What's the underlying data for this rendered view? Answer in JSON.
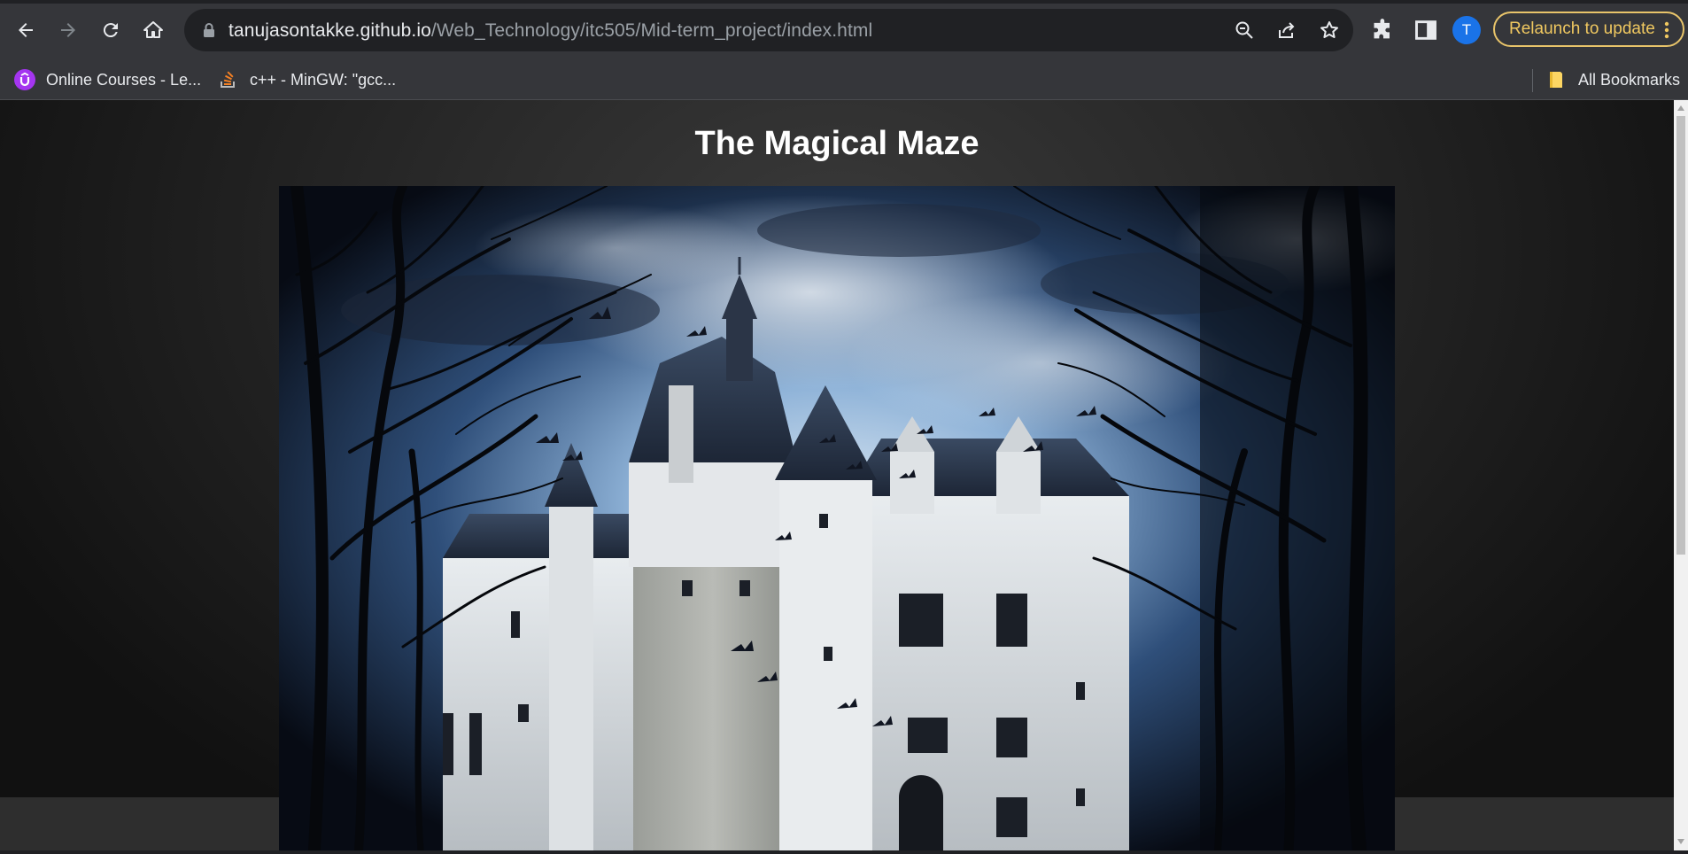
{
  "browser": {
    "url_host": "tanujasontakke.github.io",
    "url_path": "/Web_Technology/itc505/Mid-term_project/index.html",
    "avatar_letter": "T",
    "relaunch_label": "Relaunch to update",
    "accent_color": "#e8c46a"
  },
  "bookmarks": {
    "items": [
      {
        "label": "Online Courses - Le...",
        "icon": "udemy-icon"
      },
      {
        "label": "c++ - MinGW: \"gcc...",
        "icon": "stackoverflow-icon"
      }
    ],
    "all_bookmarks_label": "All Bookmarks"
  },
  "page": {
    "title": "The Magical Maze",
    "hero_image": "haunted-castle-image"
  }
}
